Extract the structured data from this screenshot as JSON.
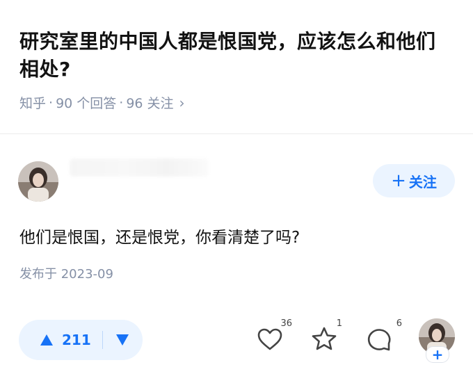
{
  "question": {
    "title": "研究室里的中国人都是恨国党，应该怎么和他们相处?",
    "source": "知乎",
    "answers": "90 个回答",
    "followers": "96 关注"
  },
  "author": {
    "follow_label": "关注"
  },
  "answer": {
    "text": "他们是恨国，还是恨党，你看清楚了吗?",
    "published": "发布于 2023-09"
  },
  "actions": {
    "upvotes": "211",
    "likes": "36",
    "favorites": "1",
    "comments": "6"
  },
  "colors": {
    "accent": "#1772f6",
    "accent_bg": "#ebf4ff",
    "muted": "#8590a6"
  },
  "icons": [
    "chevron-right-icon",
    "plus-icon",
    "upvote-triangle-icon",
    "downvote-triangle-icon",
    "heart-icon",
    "star-icon",
    "comment-bubble-icon"
  ]
}
